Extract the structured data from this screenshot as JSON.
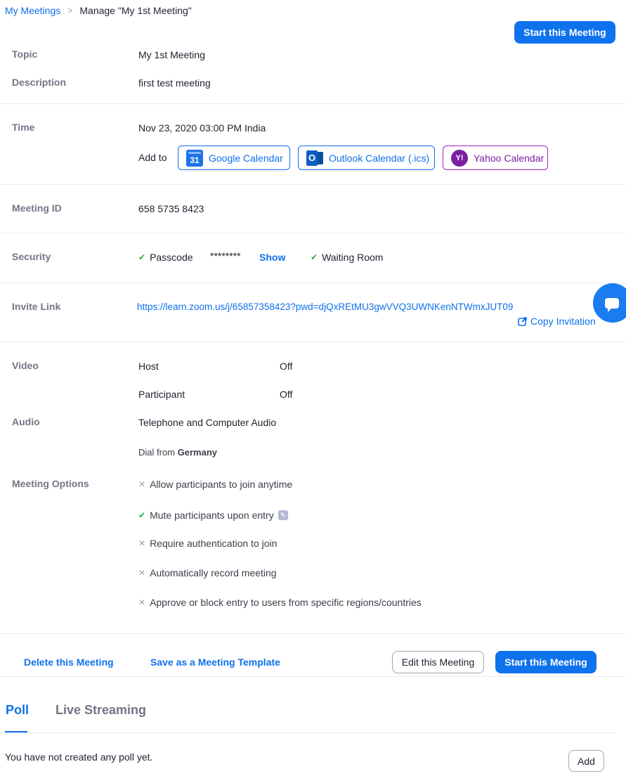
{
  "breadcrumb": {
    "parent": "My Meetings",
    "separator": ">",
    "current": "Manage \"My 1st Meeting\""
  },
  "header": {
    "start_label": "Start this Meeting"
  },
  "topic": {
    "label": "Topic",
    "value": "My 1st Meeting"
  },
  "description": {
    "label": "Description",
    "value": "first test meeting"
  },
  "time": {
    "label": "Time",
    "value": "Nov 23, 2020 03:00 PM India",
    "add_to": "Add to",
    "calendars": [
      {
        "name": "Google Calendar",
        "icon": "google-calendar-icon",
        "icon_text": "31"
      },
      {
        "name": "Outlook Calendar (.ics)",
        "icon": "outlook-icon",
        "icon_text": "O"
      },
      {
        "name": "Yahoo Calendar",
        "icon": "yahoo-icon",
        "icon_text": "Y!"
      }
    ]
  },
  "meeting_id": {
    "label": "Meeting ID",
    "value": "658 5735 8423"
  },
  "security": {
    "label": "Security",
    "passcode_label": "Passcode",
    "passcode_value": "********",
    "show_label": "Show",
    "waiting_room_label": "Waiting Room"
  },
  "invite": {
    "label": "Invite Link",
    "url": "https://learn.zoom.us/j/65857358423?pwd=djQxREtMU3gwVVQ3UWNKenNTWmxJUT09",
    "copy_label": "Copy Invitation"
  },
  "video": {
    "label": "Video",
    "host_label": "Host",
    "host_value": "Off",
    "participant_label": "Participant",
    "participant_value": "Off"
  },
  "audio": {
    "label": "Audio",
    "value": "Telephone and Computer Audio",
    "dial_prefix": "Dial from",
    "dial_country": "Germany"
  },
  "options": {
    "label": "Meeting Options",
    "items": [
      {
        "text": "Allow participants to join anytime",
        "enabled": false
      },
      {
        "text": "Mute participants upon entry",
        "enabled": true
      },
      {
        "text": "Require authentication to join",
        "enabled": false
      },
      {
        "text": "Automatically record meeting",
        "enabled": false
      },
      {
        "text": "Approve or block entry to users from specific regions/countries",
        "enabled": false
      }
    ]
  },
  "footer": {
    "delete_label": "Delete this Meeting",
    "template_label": "Save as a Meeting Template",
    "edit_label": "Edit this Meeting",
    "start_label": "Start this Meeting"
  },
  "tabs": [
    {
      "label": "Poll",
      "active": true
    },
    {
      "label": "Live Streaming",
      "active": false
    }
  ],
  "poll": {
    "empty_text": "You have not created any poll yet.",
    "add_label": "Add"
  },
  "colors": {
    "accent": "#0e72ed",
    "check": "#23b14d",
    "yahoo": "#7b1fa2"
  }
}
